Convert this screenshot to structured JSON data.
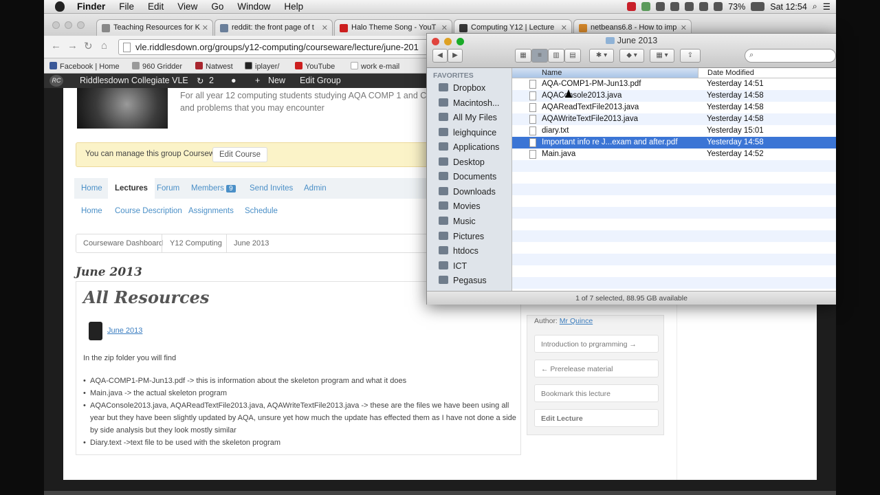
{
  "menubar": {
    "app": "Finder",
    "items": [
      "File",
      "Edit",
      "View",
      "Go",
      "Window",
      "Help"
    ],
    "battery": "73%",
    "clock": "Sat 12:54"
  },
  "browser": {
    "tabs": [
      {
        "title": "Teaching Resources for K",
        "color": "#888888"
      },
      {
        "title": "reddit: the front page of t",
        "color": "#6a7f9a"
      },
      {
        "title": "Halo Theme Song - YouT",
        "color": "#cc1f1f"
      },
      {
        "title": "Computing Y12 | Lecture",
        "color": "#3b3b3b"
      },
      {
        "title": "netbeans6.8 - How to imp",
        "color": "#d98a2b"
      }
    ],
    "url": "vle.riddlesdown.org/groups/y12-computing/courseware/lecture/june-201",
    "bookmarks": [
      {
        "label": "Facebook | Home",
        "color": "#3b5998"
      },
      {
        "label": "960 Gridder",
        "color": "#999999"
      },
      {
        "label": "Natwest",
        "color": "#a8262e"
      },
      {
        "label": "iplayer/",
        "color": "#222222"
      },
      {
        "label": "YouTube",
        "color": "#cc1f1f"
      },
      {
        "label": "work e-mail",
        "color": "#f2f2f2"
      }
    ]
  },
  "adminbar": {
    "logo": "RC",
    "site": "Riddlesdown Collegiate VLE",
    "updates": "2",
    "new_label": "New",
    "edit_group": "Edit Group"
  },
  "group": {
    "description": "For all year 12 computing students studying AQA COMP 1 and C topics and problems that you may encounter",
    "notice": "You can manage this group Courseware.",
    "edit_course": "Edit Course"
  },
  "nav_tabs": [
    "Home",
    "Lectures",
    "Forum",
    "Members",
    "Send Invites",
    "Admin"
  ],
  "members_count": "9",
  "sub_tabs": [
    "Home",
    "Course Description",
    "Assignments",
    "Schedule"
  ],
  "breadcrumb": [
    "Courseware Dashboard",
    "Y12 Computing",
    "June 2013"
  ],
  "lecture": {
    "title": "June 2013",
    "heading": "All Resources",
    "attachment": "June 2013",
    "intro": "In the zip folder you will find",
    "bullets": [
      "AQA-COMP1-PM-Jun13.pdf -> this is information about the skeleton program and what it does",
      "Main.java -> the actual skeleton program",
      "AQAConsole2013.java, AQAReadTextFile2013.java, AQAWriteTextFile2013.java -> these are the files we have been using all year but they have been slightly updated by AQA, unsure yet how much the update has effected them as I have not done a side by side analysis but they look mostly similar",
      "Diary.text ->text file to be used with the skeleton program"
    ]
  },
  "sidebar": {
    "author_label": "Author:",
    "author": "Mr Quince",
    "buttons": [
      "Introduction to prgramming →",
      "← Prerelease material",
      "Bookmark this lecture",
      "Edit Lecture"
    ]
  },
  "finder": {
    "title": "June 2013",
    "favorites_header": "FAVORITES",
    "sidebar": [
      "Dropbox",
      "Macintosh...",
      "All My Files",
      "leighquince",
      "Applications",
      "Desktop",
      "Documents",
      "Downloads",
      "Movies",
      "Music",
      "Pictures",
      "htdocs",
      "ICT",
      "Pegasus"
    ],
    "columns": [
      "Name",
      "Date Modified"
    ],
    "files": [
      {
        "name": "AQA-COMP1-PM-Jun13.pdf",
        "date": "Yesterday 14:51"
      },
      {
        "name": "AQAConsole2013.java",
        "date": "Yesterday 14:58"
      },
      {
        "name": "AQAReadTextFile2013.java",
        "date": "Yesterday 14:58"
      },
      {
        "name": "AQAWriteTextFile2013.java",
        "date": "Yesterday 14:58"
      },
      {
        "name": "diary.txt",
        "date": "Yesterday 15:01"
      },
      {
        "name": "Important info re J...exam and after.pdf",
        "date": "Yesterday 14:58"
      },
      {
        "name": "Main.java",
        "date": "Yesterday 14:52"
      }
    ],
    "selected_index": 5,
    "status": "1 of 7 selected, 88.95 GB available"
  }
}
